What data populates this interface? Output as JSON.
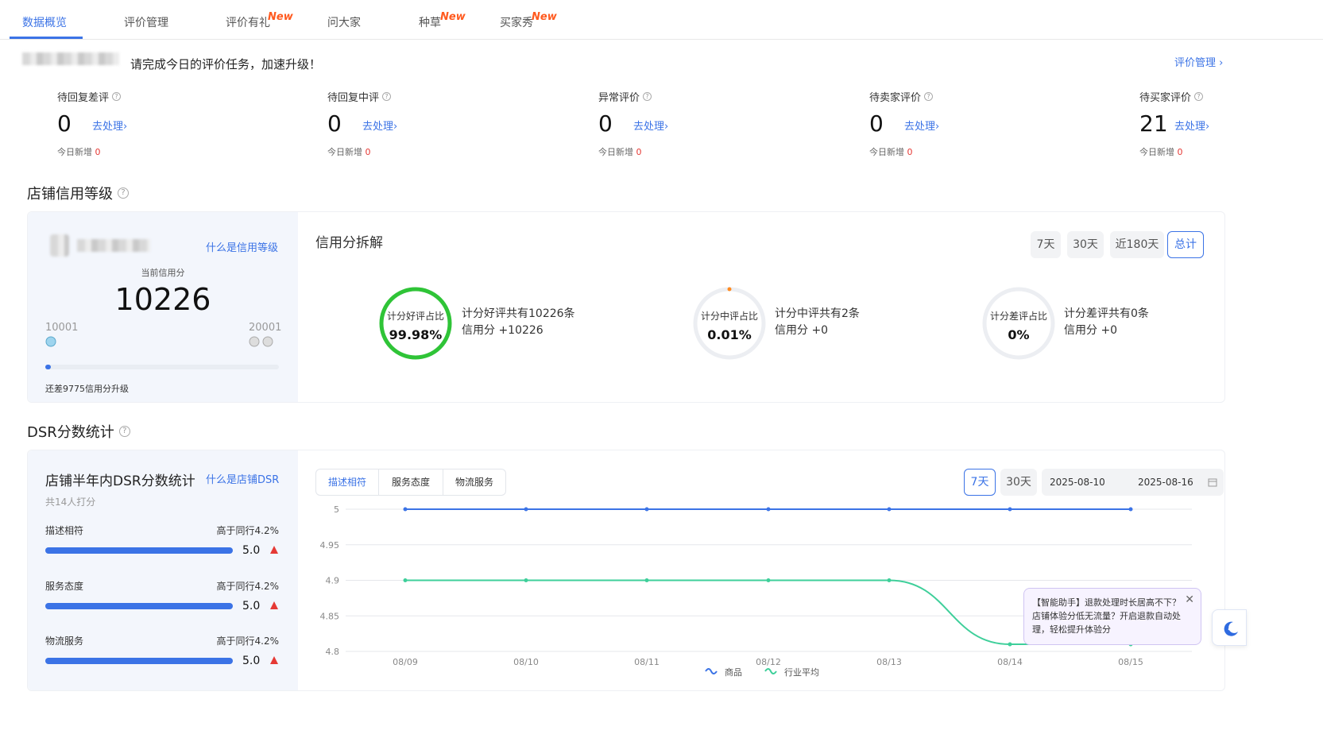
{
  "tabs": [
    {
      "label": "数据概览",
      "new": ""
    },
    {
      "label": "评价管理",
      "new": ""
    },
    {
      "label": "评价有礼",
      "new": "New"
    },
    {
      "label": "问大家",
      "new": ""
    },
    {
      "label": "种草",
      "new": "New"
    },
    {
      "label": "买家秀",
      "new": "New"
    }
  ],
  "task": {
    "text": "请完成今日的评价任务，加速升级！",
    "manage_link": "评价管理 ›"
  },
  "stats": [
    {
      "title": "待回复差评",
      "value": "0",
      "action": "去处理›",
      "new_label": "今日新增",
      "new_value": "0"
    },
    {
      "title": "待回复中评",
      "value": "0",
      "action": "去处理›",
      "new_label": "今日新增",
      "new_value": "0"
    },
    {
      "title": "异常评价",
      "value": "0",
      "action": "去处理›",
      "new_label": "今日新增",
      "new_value": "0"
    },
    {
      "title": "待卖家评价",
      "value": "0",
      "action": "去处理›",
      "new_label": "今日新增",
      "new_value": "0"
    },
    {
      "title": "待买家评价",
      "value": "21",
      "action": "去处理›",
      "new_label": "今日新增",
      "new_value": "0"
    }
  ],
  "credit": {
    "section_title": "店铺信用等级",
    "what_link": "什么是信用等级",
    "current_label": "当前信用分",
    "current_value": "10226",
    "range_min": "10001",
    "range_max": "20001",
    "progress": 0.0225,
    "remaining": "还差9775信用分升级",
    "breakdown_title": "信用分拆解",
    "periods": [
      "7天",
      "30天",
      "近180天",
      "总计"
    ],
    "active_period": "总计",
    "rings": [
      {
        "label": "计分好评占比",
        "value": "99.98%",
        "desc1": "计分好评共有10226条",
        "desc2": "信用分 +10226",
        "ratio": 0.9998,
        "color": "#2fc437"
      },
      {
        "label": "计分中评占比",
        "value": "0.01%",
        "desc1": "计分中评共有2条",
        "desc2": "信用分 +0",
        "ratio": 0.0001,
        "color": "#ff8a1f"
      },
      {
        "label": "计分差评占比",
        "value": "0%",
        "desc1": "计分差评共有0条",
        "desc2": "信用分 +0",
        "ratio": 0,
        "color": "#e53935"
      }
    ]
  },
  "dsr": {
    "section_title": "DSR分数统计",
    "card_title": "店铺半年内DSR分数统计",
    "what_link": "什么是店铺DSR",
    "raters": "共14人打分",
    "rows": [
      {
        "name": "描述相符",
        "compare": "高于同行4.2%",
        "score": "5.0",
        "fill": 1.0
      },
      {
        "name": "服务态度",
        "compare": "高于同行4.2%",
        "score": "5.0",
        "fill": 1.0
      },
      {
        "name": "物流服务",
        "compare": "高于同行4.2%",
        "score": "5.0",
        "fill": 1.0
      }
    ],
    "chart_tabs": [
      "描述相符",
      "服务态度",
      "物流服务"
    ],
    "active_chart_tab": "描述相符",
    "range_buttons": [
      "7天",
      "30天"
    ],
    "active_range": "7天",
    "date_start": "2025-08-10",
    "date_end": "2025-08-16"
  },
  "tooltip": {
    "text": "【智能助手】退款处理时长居高不下？店铺体验分低无流量？开启退款自动处理，轻松提升体验分"
  },
  "chart_data": {
    "type": "line",
    "x": [
      "08/09",
      "08/10",
      "08/11",
      "08/12",
      "08/13",
      "08/14",
      "08/15"
    ],
    "ylim": [
      4.8,
      5
    ],
    "yticks": [
      "5",
      "4.95",
      "4.9",
      "4.85",
      "4.8"
    ],
    "grid": true,
    "legend_position": "bottom",
    "series": [
      {
        "name": "商品",
        "color": "#3b73e6",
        "values": [
          5,
          5,
          5,
          5,
          5,
          5,
          5
        ]
      },
      {
        "name": "行业平均",
        "color": "#3ecf9a",
        "values": [
          4.9,
          4.9,
          4.9,
          4.9,
          4.9,
          4.81,
          4.81
        ]
      }
    ]
  }
}
